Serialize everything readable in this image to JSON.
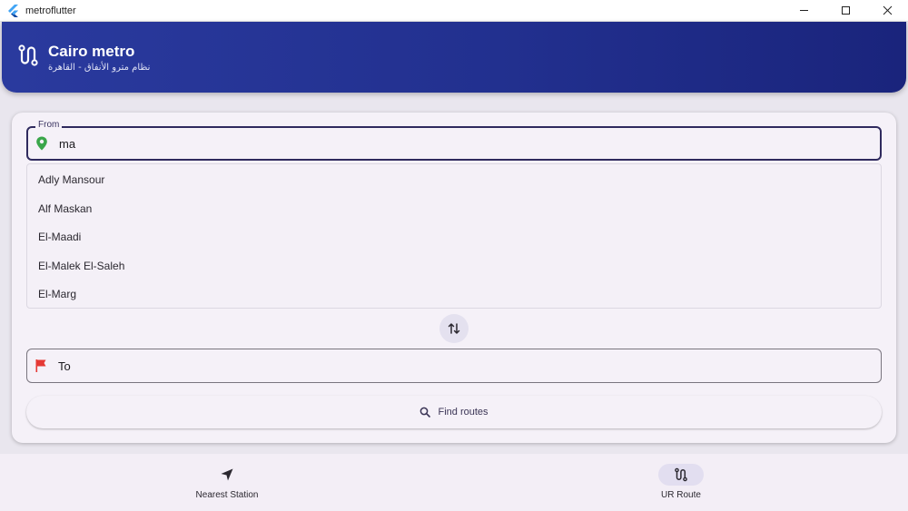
{
  "window": {
    "title": "metroflutter"
  },
  "header": {
    "title": "Cairo metro",
    "subtitle": "نظام مترو الأنفاق - القاهرة"
  },
  "form": {
    "from_label": "From",
    "from_value": "ma",
    "to_placeholder": "To",
    "suggestions": [
      "Adly Mansour",
      "Alf Maskan",
      "El-Maadi",
      "El-Malek El-Saleh",
      "El-Marg"
    ],
    "find_label": "Find routes"
  },
  "nav": {
    "items": [
      {
        "label": "Nearest Station",
        "icon": "navigation-arrow-icon",
        "selected": false
      },
      {
        "label": "UR Route",
        "icon": "route-icon",
        "selected": true
      }
    ]
  },
  "colors": {
    "header_start": "#2a3a9e",
    "header_end": "#1a247c",
    "from_pin": "#3aa64a",
    "to_flag": "#e53935",
    "accent_outline": "#2f2a5e"
  }
}
